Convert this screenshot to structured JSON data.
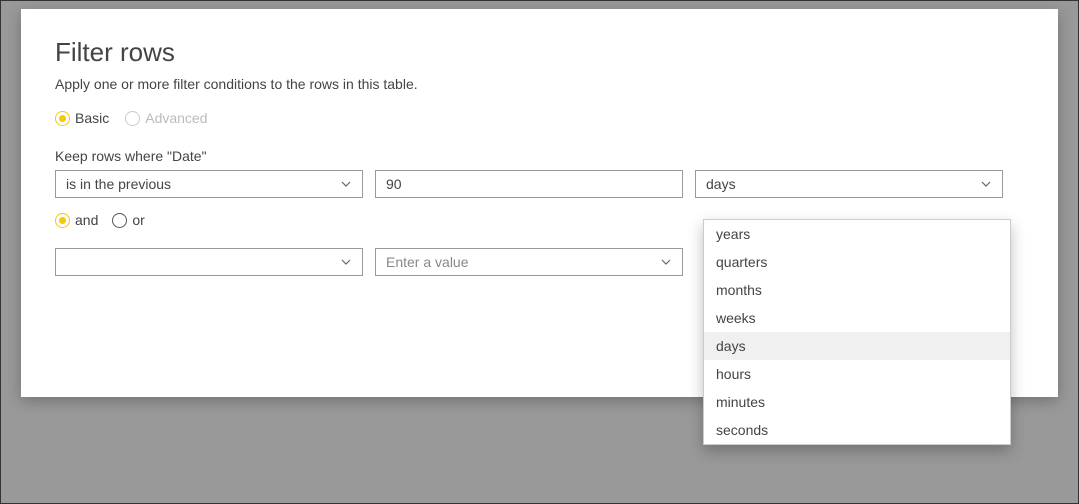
{
  "dialog": {
    "title": "Filter rows",
    "subtitle": "Apply one or more filter conditions to the rows in this table."
  },
  "mode": {
    "basic": "Basic",
    "advanced": "Advanced"
  },
  "keep_label": "Keep rows where \"Date\"",
  "row1": {
    "operator": "is in the previous",
    "value": "90",
    "unit": "days"
  },
  "logic": {
    "and": "and",
    "or": "or"
  },
  "row2": {
    "operator": "",
    "value_placeholder": "Enter a value"
  },
  "unit_options": {
    "years": "years",
    "quarters": "quarters",
    "months": "months",
    "weeks": "weeks",
    "days": "days",
    "hours": "hours",
    "minutes": "minutes",
    "seconds": "seconds"
  }
}
